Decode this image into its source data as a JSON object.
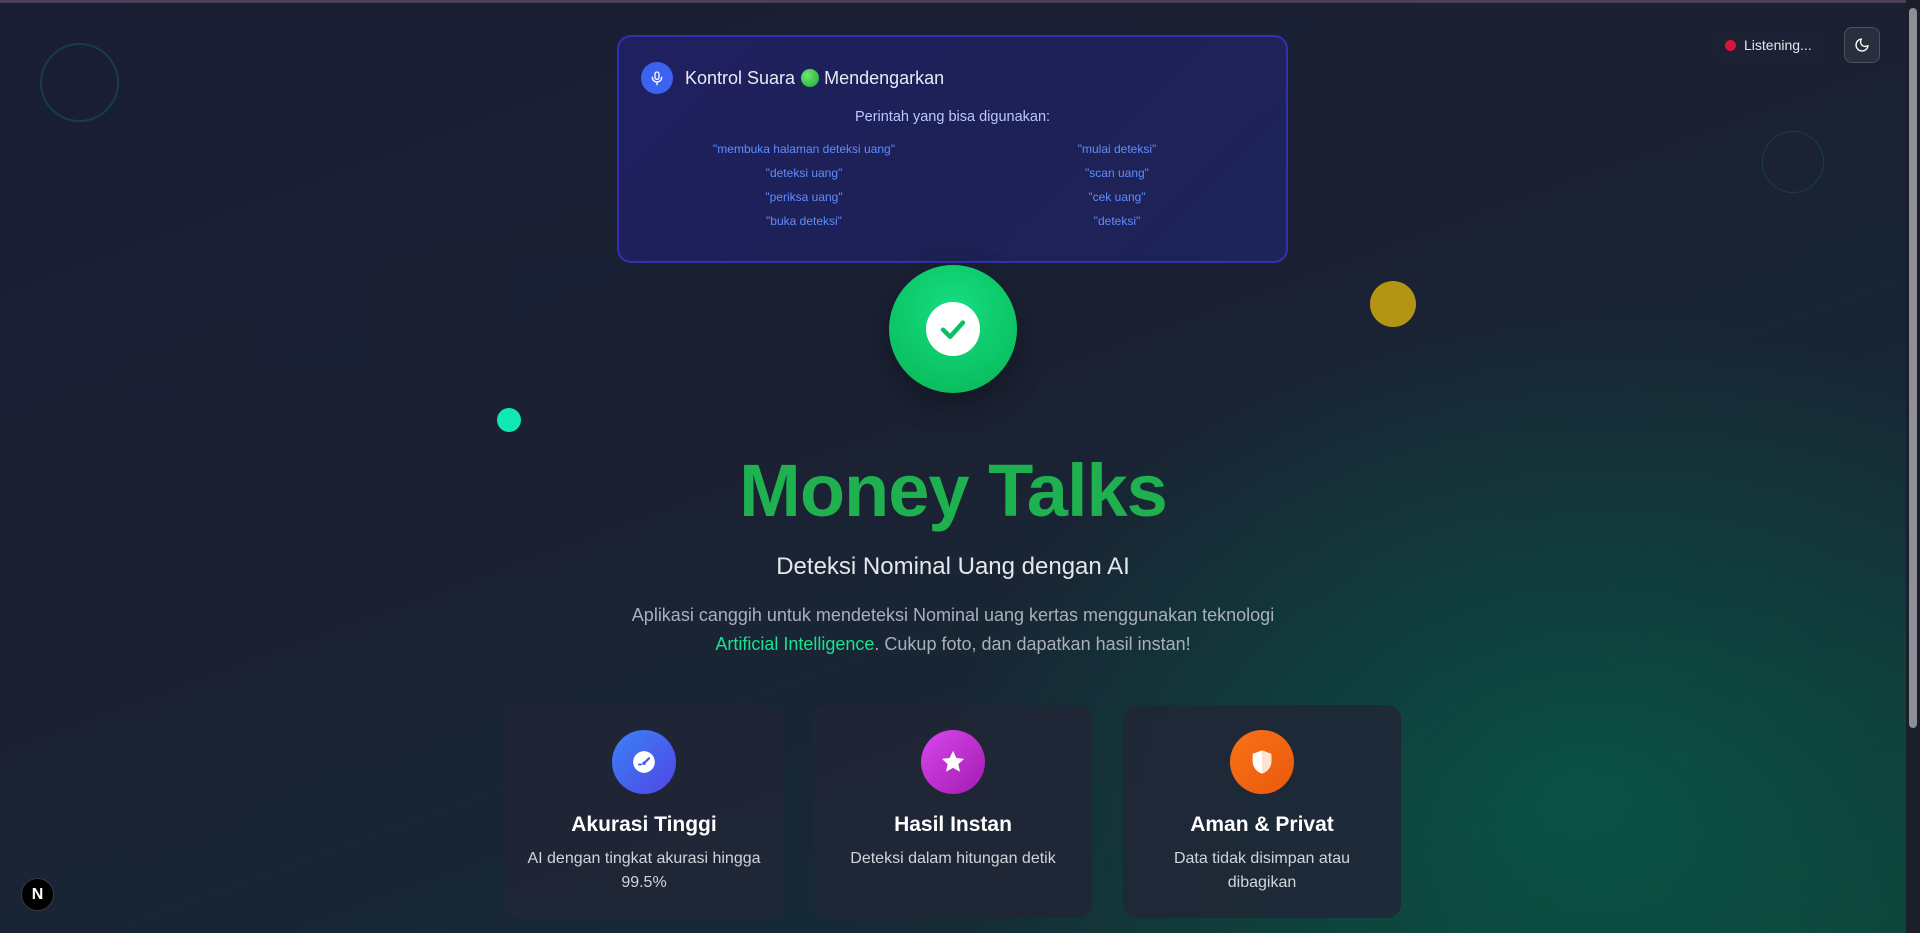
{
  "voice_panel": {
    "title": "Kontrol Suara",
    "status": "Mendengarkan",
    "commands_heading": "Perintah yang bisa digunakan:",
    "commands_left": [
      "\"membuka halaman deteksi uang\"",
      "\"deteksi uang\"",
      "\"periksa uang\"",
      "\"buka deteksi\""
    ],
    "commands_right": [
      "\"mulai deteksi\"",
      "\"scan uang\"",
      "\"cek uang\"",
      "\"deteksi\""
    ]
  },
  "header": {
    "listening_label": "Listening...",
    "theme_toggle_icon": "moon-icon"
  },
  "hero": {
    "icon": "check-circle-icon",
    "title": "Money Talks",
    "subtitle": "Deteksi Nominal Uang dengan AI",
    "description_before": "Aplikasi canggih untuk mendeteksi Nominal uang kertas menggunakan teknologi ",
    "description_highlight": "Artificial Intelligence",
    "description_after": ". Cukup foto, dan dapatkan hasil instan!"
  },
  "features": [
    {
      "icon": "gauge-icon",
      "title": "Akurasi Tinggi",
      "description": "AI dengan tingkat akurasi hingga 99.5%",
      "color": "#3b5cf6"
    },
    {
      "icon": "star-icon",
      "title": "Hasil Instan",
      "description": "Deteksi dalam hitungan detik",
      "color": "#c026d3"
    },
    {
      "icon": "shield-icon",
      "title": "Aman & Privat",
      "description": "Data tidak disimpan atau dibagikan",
      "color": "#f97316"
    }
  ],
  "dev_badge": {
    "label": "N"
  },
  "colors": {
    "brand_green": "#1fb14f",
    "highlight_green": "#19e38f",
    "panel_border": "#3330b3",
    "record_red": "#d9143a"
  }
}
